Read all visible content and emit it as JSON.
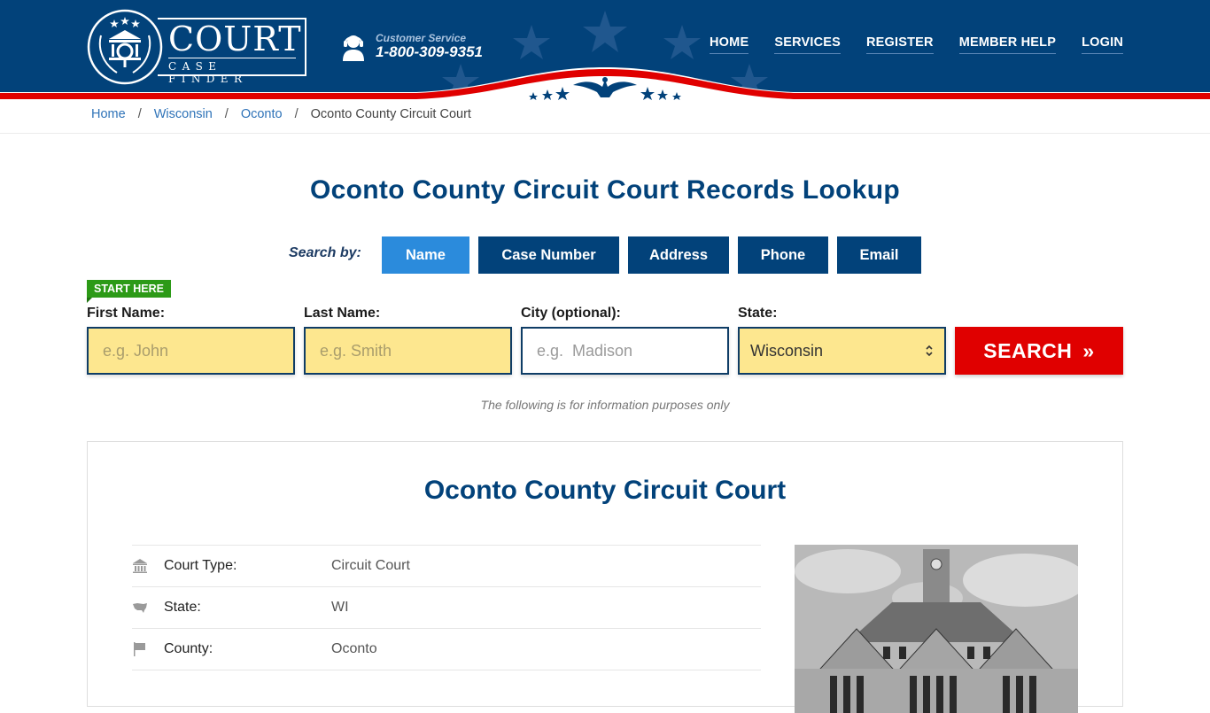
{
  "brand": {
    "name_top": "COURT",
    "name_bottom": "CASE FINDER"
  },
  "customer_service": {
    "label": "Customer Service",
    "phone": "1-800-309-9351"
  },
  "nav": {
    "items": [
      {
        "label": "HOME"
      },
      {
        "label": "SERVICES"
      },
      {
        "label": "REGISTER"
      },
      {
        "label": "MEMBER HELP"
      },
      {
        "label": "LOGIN"
      }
    ]
  },
  "breadcrumb": {
    "items": [
      {
        "label": "Home"
      },
      {
        "label": "Wisconsin"
      },
      {
        "label": "Oconto"
      }
    ],
    "separator": "/",
    "current": "Oconto County Circuit Court"
  },
  "page": {
    "title": "Oconto County Circuit Court Records Lookup"
  },
  "search": {
    "search_by_label": "Search by:",
    "tabs": [
      {
        "label": "Name",
        "active": true
      },
      {
        "label": "Case Number",
        "active": false
      },
      {
        "label": "Address",
        "active": false
      },
      {
        "label": "Phone",
        "active": false
      },
      {
        "label": "Email",
        "active": false
      }
    ],
    "start_here": "START HERE",
    "first_name": {
      "label": "First Name:",
      "placeholder": "e.g. John",
      "value": ""
    },
    "last_name": {
      "label": "Last Name:",
      "placeholder": "e.g. Smith",
      "value": ""
    },
    "city": {
      "label": "City (optional):",
      "placeholder": "e.g.  Madison",
      "value": ""
    },
    "state": {
      "label": "State:",
      "selected": "Wisconsin"
    },
    "button_label": "SEARCH",
    "button_icon": "»",
    "disclaimer": "The following is for information purposes only"
  },
  "court": {
    "title": "Oconto County Circuit Court",
    "details": [
      {
        "icon": "courthouse-icon",
        "key": "Court Type:",
        "value": "Circuit Court"
      },
      {
        "icon": "us-map-icon",
        "key": "State:",
        "value": "WI"
      },
      {
        "icon": "flag-icon",
        "key": "County:",
        "value": "Oconto"
      }
    ]
  },
  "colors": {
    "brand_blue": "#02427a",
    "accent_blue": "#2b8bdc",
    "search_red": "#e00000",
    "start_green": "#2c9a17",
    "input_yellow": "#fde78f"
  }
}
